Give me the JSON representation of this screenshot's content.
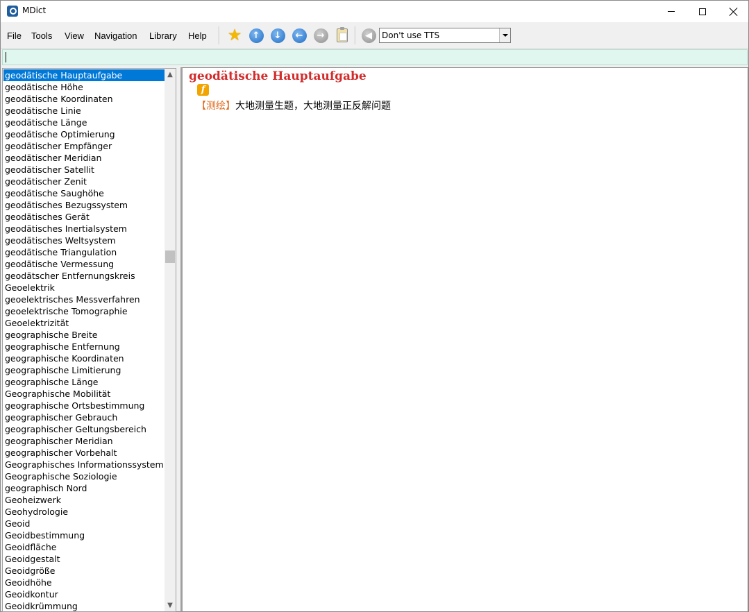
{
  "window": {
    "title": "MDict"
  },
  "menu": [
    "File",
    "Tools",
    "View",
    "Navigation",
    "Library",
    "Help"
  ],
  "toolbar": {
    "icons": [
      "star-icon",
      "arrow-up-icon",
      "arrow-down-icon",
      "arrow-left-icon",
      "arrow-right-icon",
      "clipboard-icon",
      "speaker-icon"
    ],
    "tts_selected": "Don't use TTS"
  },
  "search": {
    "value": ""
  },
  "word_list": {
    "selected_index": 0,
    "items": [
      "geodätische Hauptaufgabe",
      "geodätische Höhe",
      "geodätische Koordinaten",
      "geodätische Linie",
      "geodätische Länge",
      "geodätische Optimierung",
      "geodätischer Empfänger",
      "geodätischer Meridian",
      "geodätischer Satellit",
      "geodätischer Zenit",
      "geodätische Saughöhe",
      "geodätisches Bezugssystem",
      "geodätisches Gerät",
      "geodätisches Inertialsystem",
      "geodätisches Weltsystem",
      "geodätische Triangulation",
      "geodätische Vermessung",
      "geodätscher Entfernungskreis",
      "Geoelektrik",
      "geoelektrisches Messverfahren",
      "geoelektrische Tomographie",
      "Geoelektrizität",
      "geographische Breite",
      "geographische Entfernung",
      "geographische Koordinaten",
      "geographische Limitierung",
      "geographische Länge",
      "Geographische Mobilität",
      "geographische Ortsbestimmung",
      "geographischer Gebrauch",
      "geographischer Geltungsbereich",
      "geographischer Meridian",
      "geographischer Vorbehalt",
      "Geographisches Informationssystem",
      "Geographische Soziologie",
      "geographisch Nord",
      "Geoheizwerk",
      "Geohydrologie",
      "Geoid",
      "Geoidbestimmung",
      "Geoidfläche",
      "Geoidgestalt",
      "Geoidgröße",
      "Geoidhöhe",
      "Geoidkontur",
      "Geoidkrümmung"
    ]
  },
  "entry": {
    "headword": "geodätische Hauptaufgabe",
    "badge": "f",
    "field_label": "【测绘】",
    "definition": "大地测量生题，大地测量正反解问题"
  }
}
